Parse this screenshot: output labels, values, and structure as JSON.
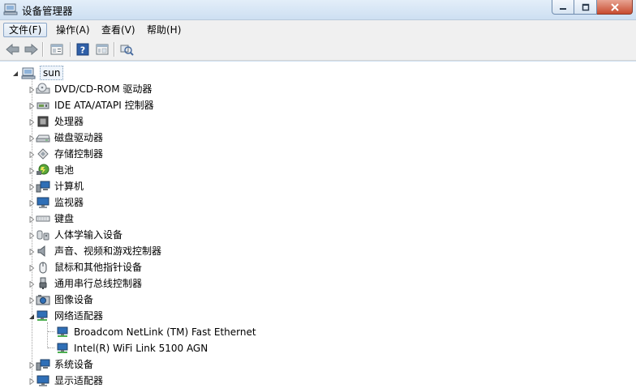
{
  "window": {
    "title": "设备管理器"
  },
  "menu": {
    "items": [
      "文件(F)",
      "操作(A)",
      "查看(V)",
      "帮助(H)"
    ]
  },
  "toolbar": {
    "buttons": [
      "back-icon",
      "forward-icon",
      "properties-icon",
      "help-icon",
      "view-icon",
      "scan-hardware-icon"
    ]
  },
  "tree": {
    "root": "sun",
    "categories": [
      {
        "label": "DVD/CD-ROM 驱动器",
        "icon": "cdrom-icon"
      },
      {
        "label": "IDE ATA/ATAPI 控制器",
        "icon": "ide-controller-icon"
      },
      {
        "label": "处理器",
        "icon": "processor-icon"
      },
      {
        "label": "磁盘驱动器",
        "icon": "disk-drive-icon"
      },
      {
        "label": "存储控制器",
        "icon": "storage-controller-icon"
      },
      {
        "label": "电池",
        "icon": "battery-icon"
      },
      {
        "label": "计算机",
        "icon": "computer-icon"
      },
      {
        "label": "监视器",
        "icon": "monitor-icon"
      },
      {
        "label": "键盘",
        "icon": "keyboard-icon"
      },
      {
        "label": "人体学输入设备",
        "icon": "hid-icon"
      },
      {
        "label": "声音、视频和游戏控制器",
        "icon": "sound-icon"
      },
      {
        "label": "鼠标和其他指针设备",
        "icon": "mouse-icon"
      },
      {
        "label": "通用串行总线控制器",
        "icon": "usb-icon"
      },
      {
        "label": "图像设备",
        "icon": "imaging-icon"
      },
      {
        "label": "网络适配器",
        "icon": "network-adapter-icon",
        "expanded": true,
        "children": [
          "Broadcom NetLink (TM) Fast Ethernet",
          "Intel(R) WiFi Link 5100 AGN"
        ]
      },
      {
        "label": "系统设备",
        "icon": "system-device-icon"
      },
      {
        "label": "显示适配器",
        "icon": "display-adapter-icon"
      }
    ]
  }
}
